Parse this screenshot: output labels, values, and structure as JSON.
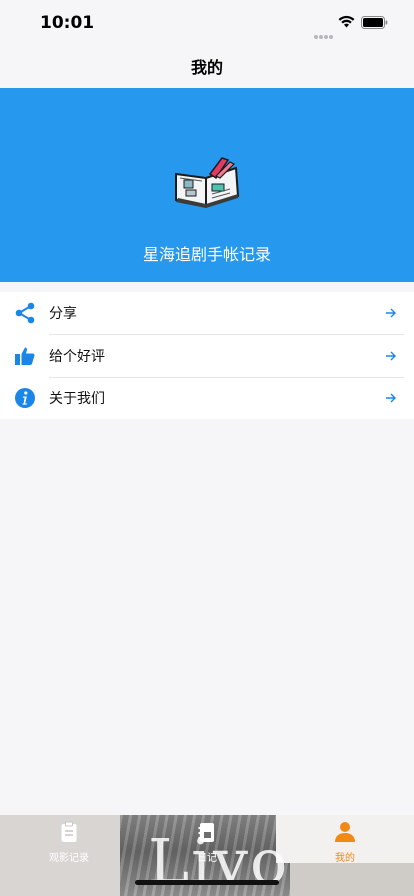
{
  "status_bar": {
    "time": "10:01"
  },
  "nav": {
    "title": "我的"
  },
  "banner": {
    "title": "星海追剧手帐记录",
    "logo": "open-book-icon",
    "background_color": "#2699ee"
  },
  "menu": {
    "items": [
      {
        "label": "分享",
        "icon": "share-icon"
      },
      {
        "label": "给个好评",
        "icon": "thumbs-up-icon"
      },
      {
        "label": "关于我们",
        "icon": "info-icon"
      }
    ],
    "icon_color": "#1a86e8"
  },
  "tab_bar": {
    "tabs": [
      {
        "label": "观影记录",
        "icon": "clipboard-icon",
        "active": false
      },
      {
        "label": "日记",
        "icon": "notebook-icon",
        "active": false
      },
      {
        "label": "我的",
        "icon": "person-icon",
        "active": true
      }
    ],
    "active_color": "#f08a14",
    "background_text": "Livo"
  }
}
